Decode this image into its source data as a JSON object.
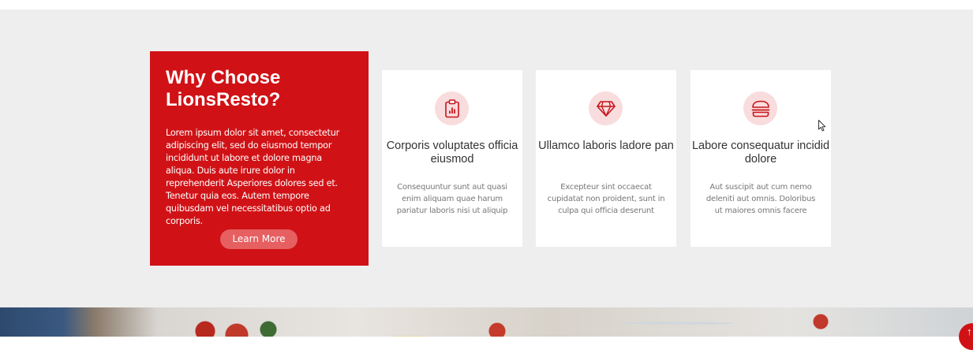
{
  "why": {
    "title": "Why Choose LionsResto?",
    "text": "Lorem ipsum dolor sit amet, consectetur adipiscing elit, sed do eiusmod tempor incididunt ut labore et dolore magna aliqua. Duis aute irure dolor in reprehenderit Asperiores dolores sed et. Tenetur quia eos. Autem tempore quibusdam vel necessitatibus optio ad corporis.",
    "button_label": "Learn More"
  },
  "cards": [
    {
      "icon": "clipboard-data-icon",
      "title": "Corporis voluptates officia eiusmod",
      "text": "Consequuntur sunt aut quasi enim aliquam quae harum pariatur laboris nisi ut aliquip"
    },
    {
      "icon": "gem-icon",
      "title": "Ullamco laboris ladore pan",
      "text": "Excepteur sint occaecat cupidatat non proident, sunt in culpa qui officia deserunt"
    },
    {
      "icon": "box-seam-icon",
      "title": "Labore consequatur incidid dolore",
      "text": "Aut suscipit aut cum nemo deleniti aut omnis. Doloribus ut maiores omnis facere"
    }
  ],
  "colors": {
    "brand_red": "#d01216",
    "icon_bg": "#f9dcdd",
    "section_bg": "#eeeeee"
  },
  "scroll_top_icon": "arrow-up-icon"
}
